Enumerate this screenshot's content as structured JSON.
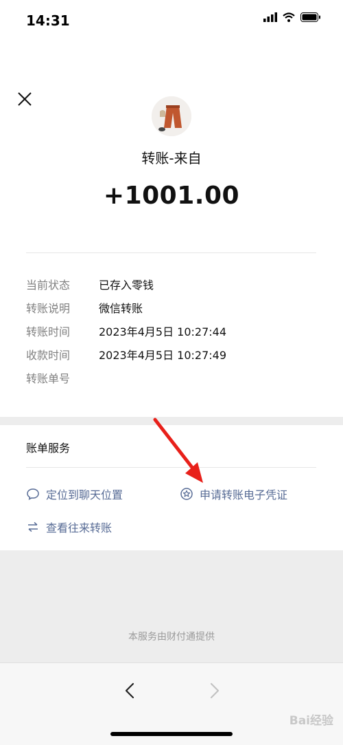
{
  "status_bar": {
    "time": "14:31"
  },
  "transfer": {
    "from_label": "转账-来自",
    "amount": "+1001.00"
  },
  "details": [
    {
      "label": "当前状态",
      "value": "已存入零钱"
    },
    {
      "label": "转账说明",
      "value": "微信转账"
    },
    {
      "label": "转账时间",
      "value": "2023年4月5日 10:27:44"
    },
    {
      "label": "收款时间",
      "value": "2023年4月5日 10:27:49"
    },
    {
      "label": "转账单号",
      "value": ""
    }
  ],
  "services": {
    "title": "账单服务",
    "locate_chat": "定位到聊天位置",
    "apply_voucher": "申请转账电子凭证",
    "view_history": "查看往来转账"
  },
  "footer": {
    "provider_text": "本服务由财付通提供"
  },
  "watermark": {
    "text": "Bai经验"
  },
  "colors": {
    "link": "#576b95",
    "annotation_arrow": "#e8201a"
  }
}
